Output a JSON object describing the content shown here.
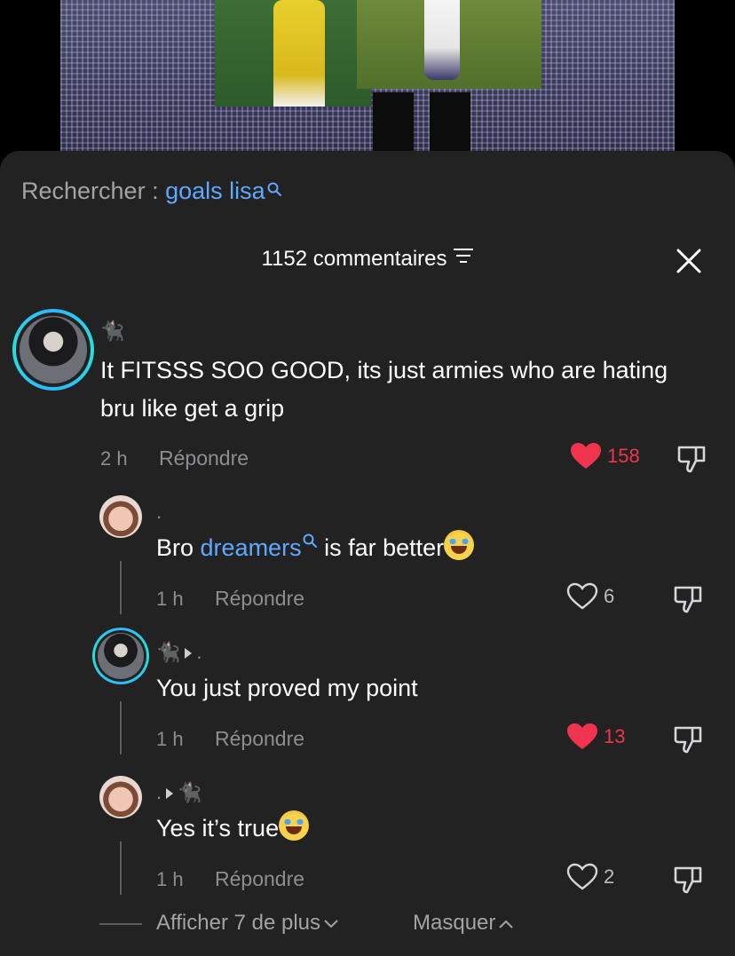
{
  "search": {
    "prefix": "Rechercher : ",
    "term": "goals lisa"
  },
  "comments_header": {
    "count_label": "1152 commentaires"
  },
  "comments": [
    {
      "username": "🐈‍⬛",
      "text": "It FITSSS SOO GOOD, its just armies who are hating bru like get a grip",
      "time": "2 h",
      "reply_label": "Répondre",
      "likes": "158",
      "liked": true
    }
  ],
  "replies": [
    {
      "username": ".",
      "text_before": "Bro ",
      "mention": "dreamers",
      "text_after": " is far better",
      "time": "1 h",
      "reply_label": "Répondre",
      "likes": "6",
      "liked": false
    },
    {
      "username": "🐈‍⬛",
      "reply_to": ".",
      "text": "You just proved my point",
      "time": "1 h",
      "reply_label": "Répondre",
      "likes": "13",
      "liked": true
    },
    {
      "username": ".",
      "reply_to": "🐈‍⬛",
      "text": "Yes it’s true",
      "time": "1 h",
      "reply_label": "Répondre",
      "likes": "2",
      "liked": false
    }
  ],
  "footer": {
    "more_label": "Afficher 7 de plus",
    "hide_label": "Masquer"
  },
  "colors": {
    "accent_blue": "#5fa8ff",
    "like_red": "#f0344f",
    "sheet_bg": "#222223"
  }
}
